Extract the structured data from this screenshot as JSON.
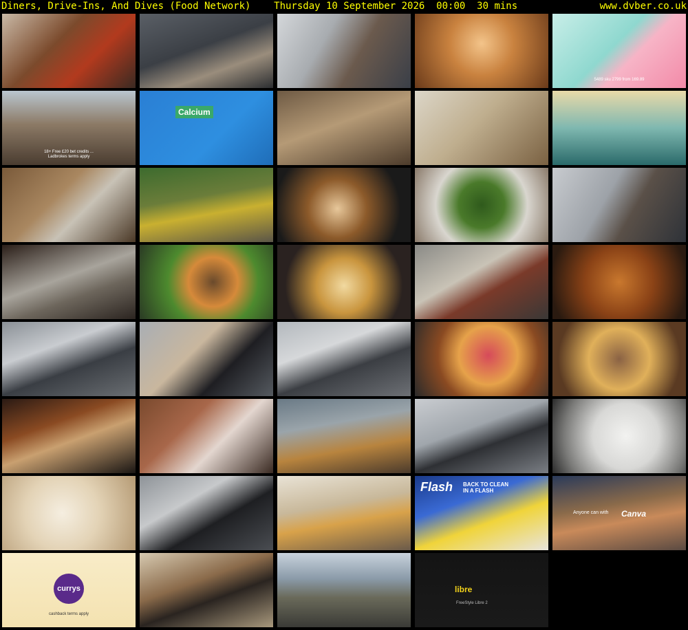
{
  "header": {
    "title": "Diners, Drive-Ins, And Dives (Food Network)    Thursday 10 September 2026  00:00  30 mins",
    "site": "www.dvber.co.uk"
  },
  "colors": {
    "header_text": "#ffff00",
    "background": "#000000"
  },
  "thumbnails": [
    {
      "name": "thumb-cooked-meat-tomatoes",
      "bg": "linear-gradient(135deg,#c9b9a6 0%,#7b4a2c 40%,#b23a1e 65%,#3a2a22 100%)"
    },
    {
      "name": "thumb-kitchen-two-chefs",
      "bg": "linear-gradient(160deg,#5a5f66 0%,#3b3f45 45%,#9a8d7c 70%,#2c2e31 100%)"
    },
    {
      "name": "thumb-chef-closeup-kitchen",
      "bg": "linear-gradient(120deg,#d4d7da 0%,#a8acb0 35%,#6b5a4d 60%,#3a3f48 100%)"
    },
    {
      "name": "thumb-wooden-lattice-ceiling",
      "bg": "radial-gradient(circle at 50% 40%,#f3c48a 0%,#c9823f 40%,#6a3a1a 100%)"
    },
    {
      "name": "thumb-pink-blob-tablet-ad",
      "bg": "linear-gradient(135deg,#c8eee8 0%,#8fd8cf 45%,#f7b4c6 60%,#f28aa8 100%)",
      "caption": "5489 sku 2799 from 169.89"
    },
    {
      "name": "thumb-crowd-street-ad",
      "bg": "linear-gradient(180deg,#b9c6cf 0%,#8c7a66 45%,#4a3c30 100%)",
      "caption": "18+ Free £20 bet credits ...\nLadbrokes terms apply"
    },
    {
      "name": "thumb-calcium-book-ad",
      "bg": "linear-gradient(135deg,#2a7fd4 0%,#2e8fe0 60%,#1f6db8 100%)",
      "label": "Calcium"
    },
    {
      "name": "thumb-animated-animals",
      "bg": "linear-gradient(160deg,#6e5a44 0%,#b59a76 45%,#4c3b2b 100%)"
    },
    {
      "name": "thumb-woman-headphones-duster",
      "bg": "linear-gradient(135deg,#dcd6c8 0%,#bfae8e 45%,#7a6142 100%)"
    },
    {
      "name": "thumb-stadium-net",
      "bg": "linear-gradient(180deg,#e9d9a8 0%,#7fb8b0 50%,#2a6a6a 100%)"
    },
    {
      "name": "thumb-empty-room-window",
      "bg": "linear-gradient(135deg,#7a5a3a 0%,#a98760 40%,#c8c2b6 60%,#4a3826 100%)"
    },
    {
      "name": "thumb-yellow-excavator",
      "bg": "linear-gradient(170deg,#3d6b2e 0%,#6b7d3a 40%,#c9b030 60%,#5a5548 100%)"
    },
    {
      "name": "thumb-frying-pan",
      "bg": "radial-gradient(circle at 45% 55%,#e7c79a 0%,#8c5a2a 35%,#1a1a1a 75%)"
    },
    {
      "name": "thumb-green-salad-bowl",
      "bg": "radial-gradient(circle at 50% 50%,#2f5a1c 0%,#4a7a2a 30%,#d9d6cf 60%,#8a7a6a 100%)"
    },
    {
      "name": "thumb-chef-glasses-kitchen",
      "bg": "linear-gradient(120deg,#c8cbcf 0%,#9da2a8 40%,#5a5048 60%,#2e3238 100%)"
    },
    {
      "name": "thumb-metal-mixing-bowl",
      "bg": "linear-gradient(160deg,#2a1e18 0%,#a8a49c 45%,#6d665c 65%,#2b2420 100%)"
    },
    {
      "name": "thumb-burger-sauce",
      "bg": "radial-gradient(circle at 55% 50%,#6a4a2c 0%,#d68a3a 30%,#4d8a2e 55%,#2a3a24 100%)"
    },
    {
      "name": "thumb-fried-cauliflower",
      "bg": "radial-gradient(circle at 50% 55%,#f1d9a0 0%,#c9953e 35%,#2a2220 75%)"
    },
    {
      "name": "thumb-gloved-hand-sandwich",
      "bg": "linear-gradient(150deg,#8a8a86 0%,#c9c3b6 40%,#7a3a2a 60%,#3a3836 100%)"
    },
    {
      "name": "thumb-roast-chicken-grill",
      "bg": "radial-gradient(circle at 50% 50%,#c9782e 0%,#8a4216 45%,#2a1a10 90%)"
    },
    {
      "name": "thumb-two-chefs-kitchen-a",
      "bg": "linear-gradient(160deg,#8a9096 0%,#c9ccd0 35%,#3a3e44 60%,#6a6e72 100%)"
    },
    {
      "name": "thumb-chef-black-jacket-closeup",
      "bg": "linear-gradient(135deg,#a9aeb4 0%,#c9b79e 40%,#1e1e22 65%,#555a60 100%)"
    },
    {
      "name": "thumb-two-chefs-kitchen-b",
      "bg": "linear-gradient(160deg,#b3b8bd 0%,#d6d8da 35%,#3b3e43 60%,#6d7075 100%)"
    },
    {
      "name": "thumb-pulled-meat-sandwich",
      "bg": "radial-gradient(circle at 55% 45%,#d64a5a 0%,#e6a24a 35%,#8a4a22 60%,#2a2a2a 100%)"
    },
    {
      "name": "thumb-loaded-fries",
      "bg": "radial-gradient(circle at 50% 50%,#8a6244 0%,#e0b05a 40%,#5a3a22 80%)"
    },
    {
      "name": "thumb-roasting-meat-oven",
      "bg": "linear-gradient(160deg,#2a1a14 0%,#8a4a22 35%,#c9a070 55%,#1a1614 100%)"
    },
    {
      "name": "thumb-woman-portrait",
      "bg": "linear-gradient(135deg,#7a4a2e 0%,#a8674a 35%,#e3d6cf 60%,#3a2a22 100%)"
    },
    {
      "name": "thumb-diner-counter",
      "bg": "linear-gradient(170deg,#6a7a86 0%,#9aa4aa 35%,#b8843e 65%,#4a3a2c 100%)"
    },
    {
      "name": "thumb-chef-interview-kitchen",
      "bg": "linear-gradient(160deg,#c9ccd0 0%,#a0a6ac 40%,#2e3034 60%,#7a7e84 100%)"
    },
    {
      "name": "thumb-white-sauce-pepper",
      "bg": "radial-gradient(circle at 55% 50%,#f2f2f0 0%,#d8d8d6 40%,#7a7a78 75%,#2a2a2a 100%)"
    },
    {
      "name": "thumb-mashed-potatoes",
      "bg": "radial-gradient(circle at 45% 50%,#f5eee0 0%,#e3d3b6 45%,#b59a74 100%)"
    },
    {
      "name": "thumb-chef-profile-kitchen",
      "bg": "linear-gradient(150deg,#8e9398 0%,#c7c9cb 35%,#1e1f22 60%,#4a4d52 100%)"
    },
    {
      "name": "thumb-living-room-dog",
      "bg": "linear-gradient(170deg,#e9e3d6 0%,#c8b89a 40%,#d8a24a 60%,#6a5a4a 100%)"
    },
    {
      "name": "thumb-flash-cleaning-ad",
      "bg": "linear-gradient(160deg,#1a3a8a 0%,#3a6ad4 35%,#f0d43a 60%,#e8e4dc 100%)",
      "brand": "Flash",
      "caption": "BACK TO CLEAN\nIN A FLASH"
    },
    {
      "name": "thumb-dog-canva-ad",
      "bg": "linear-gradient(170deg,#2a3a5a 0%,#8a6a4a 40%,#c98a5a 60%,#5a4a42 100%)",
      "brand": "Canva",
      "caption": "Anyone can with"
    },
    {
      "name": "thumb-currys-ad",
      "bg": "linear-gradient(180deg,#f8ecc8 0%,#f4e2b0 100%)",
      "brand": "currys",
      "caption": "cashback terms apply"
    },
    {
      "name": "thumb-woman-jacket-street",
      "bg": "linear-gradient(160deg,#d6c9b0 0%,#8a6a4a 40%,#2a2420 60%,#a8987c 100%)"
    },
    {
      "name": "thumb-car-mountain-road",
      "bg": "linear-gradient(180deg,#c8d2dc 0%,#8a9aa8 35%,#6a6a5a 60%,#3a3a36 100%)"
    },
    {
      "name": "thumb-libre-ad",
      "bg": "linear-gradient(180deg,#141414 0%,#1a1a1a 100%)",
      "brand": "libre",
      "caption": "FreeStyle Libre 2"
    }
  ]
}
